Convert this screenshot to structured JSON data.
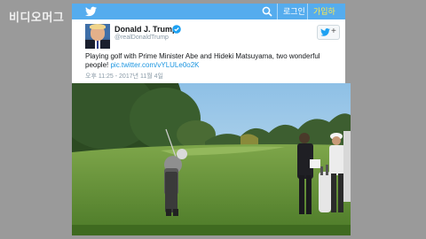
{
  "watermark": "비디오머그",
  "twitter_bar": {
    "login_label": "로그인",
    "join_label": "가입하기"
  },
  "tweet": {
    "display_name": "Donald J. Trump",
    "handle": "@realDonaldTrump",
    "text": "Playing golf with Prime Minister Abe and Hideki Matsuyama, two wonderful people! ",
    "link": "pic.twitter.com/vYLULe0o2K",
    "timestamp": "오후 11:25 - 2017년 11월 4일"
  },
  "colors": {
    "twitter_blue": "#55acee",
    "join_yellow": "#ffe94d",
    "link_blue": "#1b95e0"
  },
  "icons": [
    "twitter-bird-icon",
    "search-icon",
    "verified-badge-icon",
    "follow-bird-icon"
  ]
}
